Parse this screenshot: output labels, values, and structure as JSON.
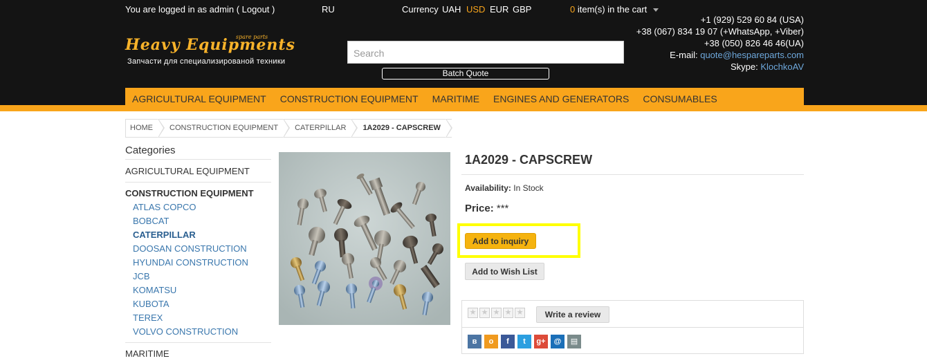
{
  "topbar": {
    "logged_in_text": "You are logged in as admin (",
    "logout": "Logout",
    "logged_in_close": ")",
    "language": "RU",
    "currency_label": "Currency",
    "currencies": [
      "UAH",
      "USD",
      "EUR",
      "GBP"
    ],
    "active_currency": "USD",
    "cart_count": "0",
    "cart_text": "item(s) in the cart"
  },
  "logo": {
    "title": "Heavy Equipments",
    "spare": "spare parts",
    "subtitle": "Запчасти для специализированой техники"
  },
  "search": {
    "placeholder": "Search"
  },
  "batch_quote": "Batch Quote",
  "contacts": {
    "phone_usa": "+1 (929) 529 60 84 (USA)",
    "phone_whatsapp": "+38 (067) 834 19 07 (+WhatsApp, +Viber)",
    "phone_ua": "+38 (050) 826 46 46(UA)",
    "email_label": "E-mail:",
    "email": "quote@hespareparts.com",
    "skype_label": "Skype:",
    "skype": "KlochkoAV"
  },
  "nav": [
    "AGRICULTURAL EQUIPMENT",
    "CONSTRUCTION EQUIPMENT",
    "MARITIME",
    "ENGINES AND GENERATORS",
    "CONSUMABLES"
  ],
  "breadcrumb": [
    "HOME",
    "CONSTRUCTION EQUIPMENT",
    "CATERPILLAR",
    "1A2029 - CAPSCREW"
  ],
  "sidebar": {
    "title": "Categories",
    "agricultural": "AGRICULTURAL EQUIPMENT",
    "construction": "CONSTRUCTION EQUIPMENT",
    "subs": [
      "ATLAS COPCO",
      "BOBCAT",
      "CATERPILLAR",
      "DOOSAN CONSTRUCTION",
      "HYUNDAI CONSTRUCTION",
      "JCB",
      "KOMATSU",
      "KUBOTA",
      "TEREX",
      "VOLVO CONSTRUCTION"
    ],
    "maritime": "MARITIME"
  },
  "product": {
    "title": "1A2029 - CAPSCREW",
    "availability_label": "Availability:",
    "availability": "In Stock",
    "price_label": "Price:",
    "price": "***",
    "add_inquiry": "Add to inquiry",
    "add_wishlist": "Add to Wish List",
    "write_review": "Write a review"
  },
  "colors": {
    "accent": "#f9a51b",
    "header_bg": "#141414",
    "link": "#3a77ad",
    "highlight": "#ffff00"
  },
  "social_icons": [
    "vk-icon",
    "odnoklassniki-icon",
    "facebook-icon",
    "twitter-icon",
    "google-plus-icon",
    "email-icon",
    "print-icon"
  ]
}
